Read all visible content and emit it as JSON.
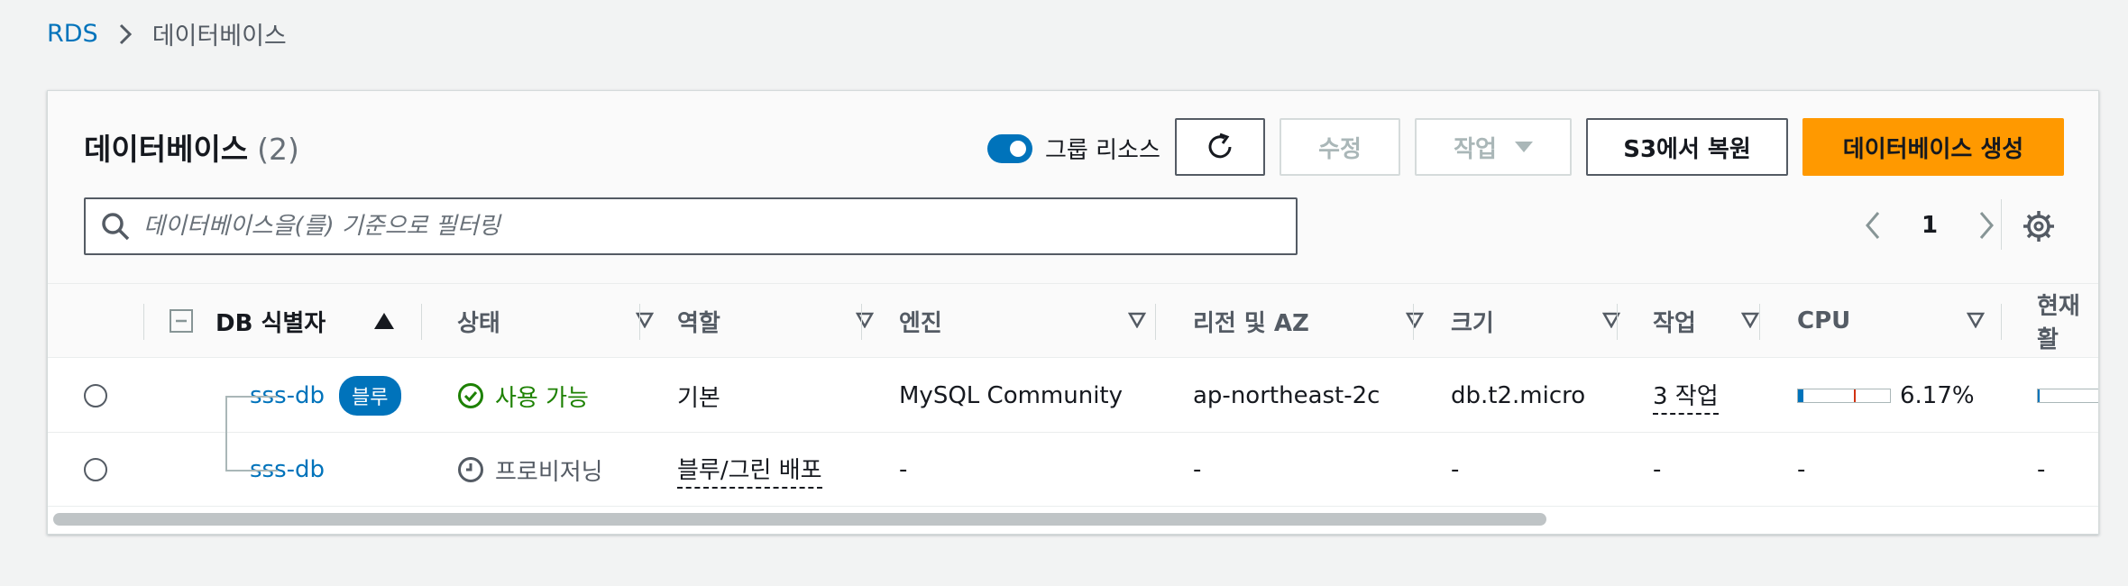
{
  "breadcrumb": {
    "root": "RDS",
    "current": "데이터베이스"
  },
  "panel": {
    "title": "데이터베이스",
    "count": "(2)",
    "toggle_label": "그룹 리소스",
    "buttons": {
      "modify": "수정",
      "actions": "작업",
      "restore": "S3에서 복원",
      "create": "데이터베이스 생성"
    },
    "search_placeholder": "데이터베이스을(를) 기준으로 필터링",
    "page": "1"
  },
  "columns": {
    "id": "DB 식별자",
    "status": "상태",
    "role": "역할",
    "engine": "엔진",
    "region": "리전 및 AZ",
    "size": "크기",
    "actions": "작업",
    "cpu": "CPU",
    "current": "현재 활"
  },
  "rows": [
    {
      "id": "sss-db",
      "badge": "블루",
      "status": "사용 가능",
      "role": "기본",
      "engine": "MySQL Community",
      "region": "ap-northeast-2c",
      "size": "db.t2.micro",
      "actions": "3 작업",
      "cpu": "6.17%",
      "cpu_fraction": 0.0617
    },
    {
      "id": "sss-db",
      "status": "프로비저닝",
      "role": "블루/그린 배포",
      "engine": "-",
      "region": "-",
      "size": "-",
      "actions": "-",
      "cpu": "-",
      "current": "-"
    }
  ],
  "colors": {
    "link": "#0073bb",
    "primary": "#ff9900",
    "success": "#1d8102"
  }
}
